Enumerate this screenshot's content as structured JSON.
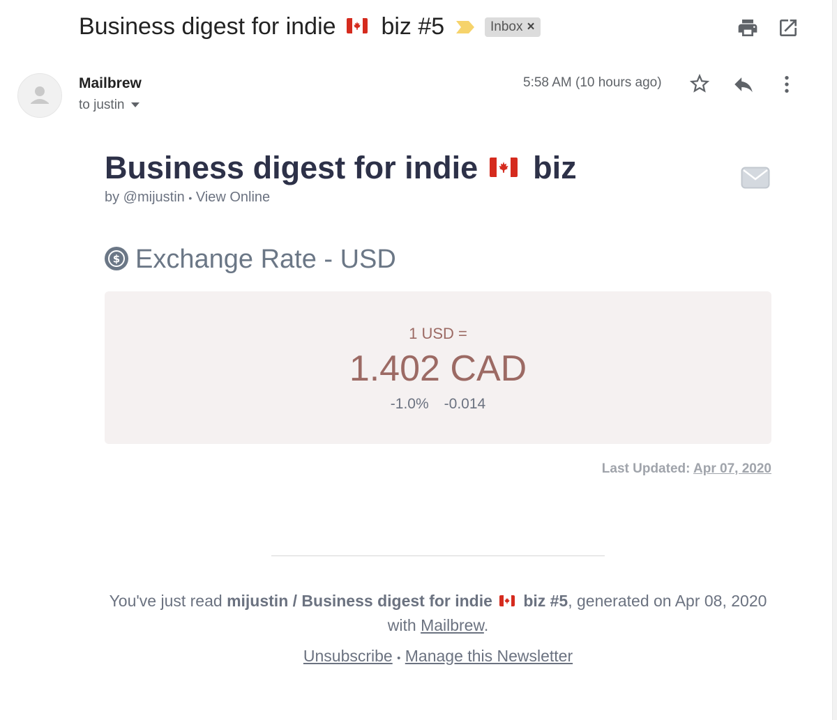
{
  "header": {
    "subject_before_flag": "Business digest for indie",
    "subject_after_flag": "biz #5",
    "label_chip": "Inbox",
    "label_remove": "×"
  },
  "message": {
    "sender": "Mailbrew",
    "recipient": "to justin",
    "timestamp": "5:58 AM (10 hours ago)"
  },
  "newsletter": {
    "title_before_flag": "Business digest for indie",
    "title_after_flag": "biz",
    "byline_author": "by @mijustin",
    "byline_sep": "•",
    "byline_link": "View Online",
    "section": {
      "icon": "dollar-circle-icon",
      "heading": "Exchange Rate - USD"
    },
    "rate_card": {
      "base": "1 USD =",
      "value": "1.402 CAD",
      "percent_change": "-1.0%",
      "abs_change": "-0.014"
    },
    "last_updated_label": "Last Updated:",
    "last_updated_date": "Apr 07, 2020"
  },
  "footer": {
    "prefix": "You've just read",
    "digest_name_before_flag": "mijustin / Business digest for indie",
    "digest_name_after_flag": "biz #5",
    "generated": ", generated on Apr 08, 2020",
    "with_text": "with",
    "mailbrew_link": "Mailbrew",
    "period": ".",
    "unsubscribe": "Unsubscribe",
    "links_sep": "•",
    "manage": "Manage this Newsletter"
  },
  "colors": {
    "title": "#2d3148",
    "rate_accent": "#9c6a64",
    "rate_card_bg": "#f5f1f1",
    "flag_red": "#d52b1e"
  }
}
